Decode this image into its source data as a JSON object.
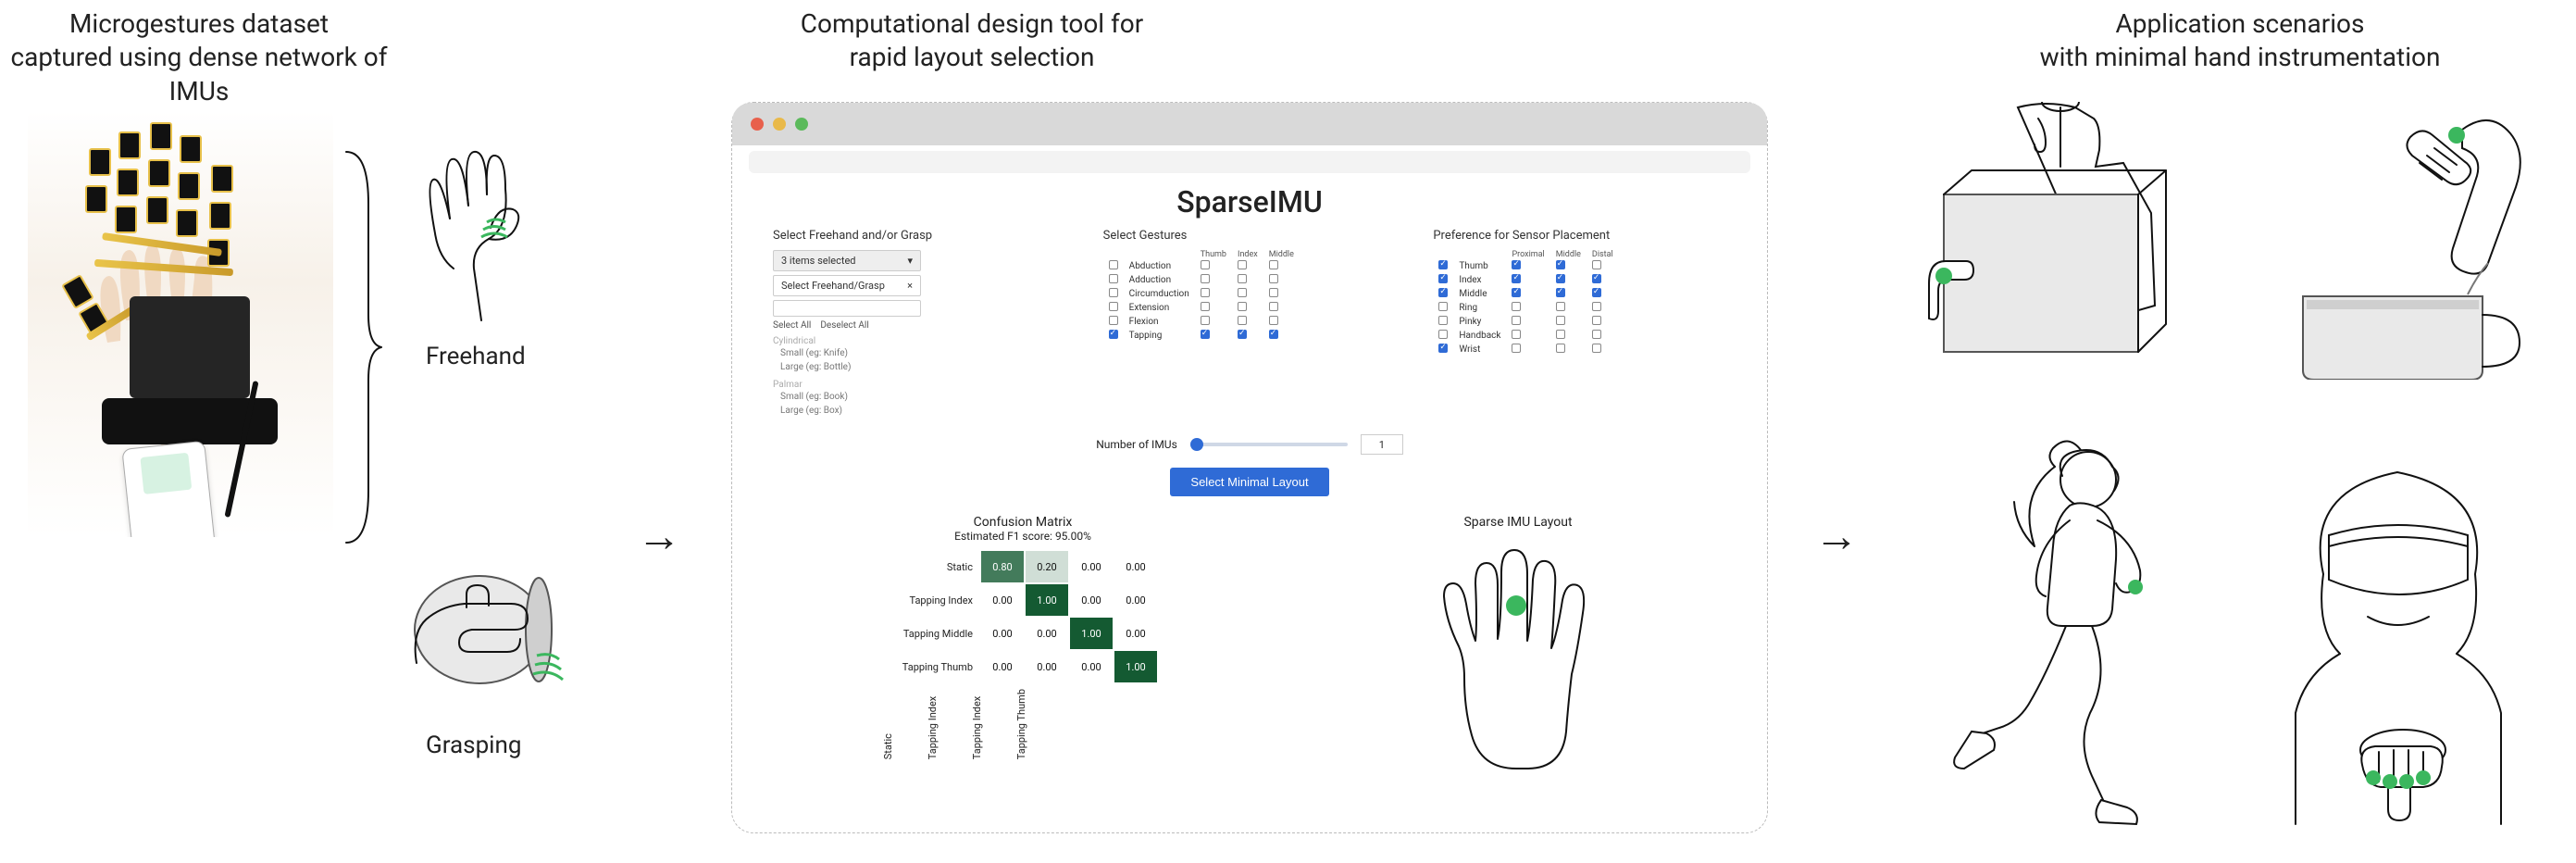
{
  "headers": {
    "left_1": "Microgestures dataset",
    "left_2": "captured using dense network of IMUs",
    "center_1": "Computational design tool for",
    "center_2": "rapid layout selection",
    "right_1": "Application scenarios",
    "right_2": "with minimal hand instrumentation"
  },
  "mini": {
    "freehand": "Freehand",
    "grasping": "Grasping"
  },
  "arrows": {
    "a1": "→",
    "a2": "→"
  },
  "tool": {
    "title": "SparseIMU",
    "sec1": "Select Freehand and/or Grasp",
    "dropdown1": "3 items selected",
    "dropdown1_caret": "▾",
    "dropdown2": "Select Freehand/Grasp",
    "dropdown2_x": "×",
    "btn_selectall": "Select All",
    "btn_deselectall": "Deselect All",
    "group1": "Cylindrical",
    "g1a": "Small (eg: Knife)",
    "g1b": "Large (eg: Bottle)",
    "group2": "Palmar",
    "g2a": "Small (eg: Book)",
    "g2b": "Large (eg: Box)",
    "sec2": "Select Gestures",
    "gesture_cols": [
      "Thumb",
      "Index",
      "Middle"
    ],
    "gestures": [
      {
        "name": "Abduction",
        "cells": [
          0,
          0,
          0
        ]
      },
      {
        "name": "Adduction",
        "cells": [
          0,
          0,
          0
        ]
      },
      {
        "name": "Circumduction",
        "cells": [
          0,
          0,
          0
        ]
      },
      {
        "name": "Extension",
        "cells": [
          0,
          0,
          0
        ]
      },
      {
        "name": "Flexion",
        "cells": [
          0,
          0,
          0
        ]
      },
      {
        "name": "Tapping",
        "cells": [
          1,
          1,
          1
        ]
      }
    ],
    "sec3": "Preference for Sensor Placement",
    "pref_cols": [
      "Proximal",
      "Middle",
      "Distal"
    ],
    "prefs": [
      {
        "name": "Thumb",
        "on": 1,
        "cells": [
          1,
          1,
          0
        ]
      },
      {
        "name": "Index",
        "on": 1,
        "cells": [
          1,
          1,
          1
        ]
      },
      {
        "name": "Middle",
        "on": 1,
        "cells": [
          1,
          1,
          1
        ]
      },
      {
        "name": "Ring",
        "on": 0,
        "cells": [
          0,
          0,
          0
        ]
      },
      {
        "name": "Pinky",
        "on": 0,
        "cells": [
          0,
          0,
          0
        ]
      },
      {
        "name": "Handback",
        "on": 0,
        "cells": [
          0,
          0,
          0
        ]
      },
      {
        "name": "Wrist",
        "on": 1,
        "cells": [
          0,
          0,
          0
        ]
      }
    ],
    "num_label": "Number of IMUs",
    "num_value": "1",
    "action": "Select Minimal Layout",
    "cm_title": "Confusion Matrix",
    "cm_sub": "Estimated F1 score: 95.00%",
    "cm_rows": [
      "Static",
      "Tapping Index",
      "Tapping Middle",
      "Tapping Thumb"
    ],
    "cm_cols": [
      "Static",
      "Tapping Index",
      "Tapping Index",
      "Tapping Thumb"
    ],
    "layout_title": "Sparse IMU Layout"
  },
  "chart_data": {
    "type": "heatmap",
    "title": "Confusion Matrix",
    "subtitle": "Estimated F1 score: 95.00%",
    "row_labels": [
      "Static",
      "Tapping Index",
      "Tapping Middle",
      "Tapping Thumb"
    ],
    "col_labels": [
      "Static",
      "Tapping Index",
      "Tapping Index",
      "Tapping Thumb"
    ],
    "matrix": [
      [
        0.8,
        0.2,
        0.0,
        0.0
      ],
      [
        0.0,
        1.0,
        0.0,
        0.0
      ],
      [
        0.0,
        0.0,
        1.0,
        0.0
      ],
      [
        0.0,
        0.0,
        0.0,
        1.0
      ]
    ],
    "value_range": [
      0,
      1
    ],
    "colorscale": "greens"
  }
}
